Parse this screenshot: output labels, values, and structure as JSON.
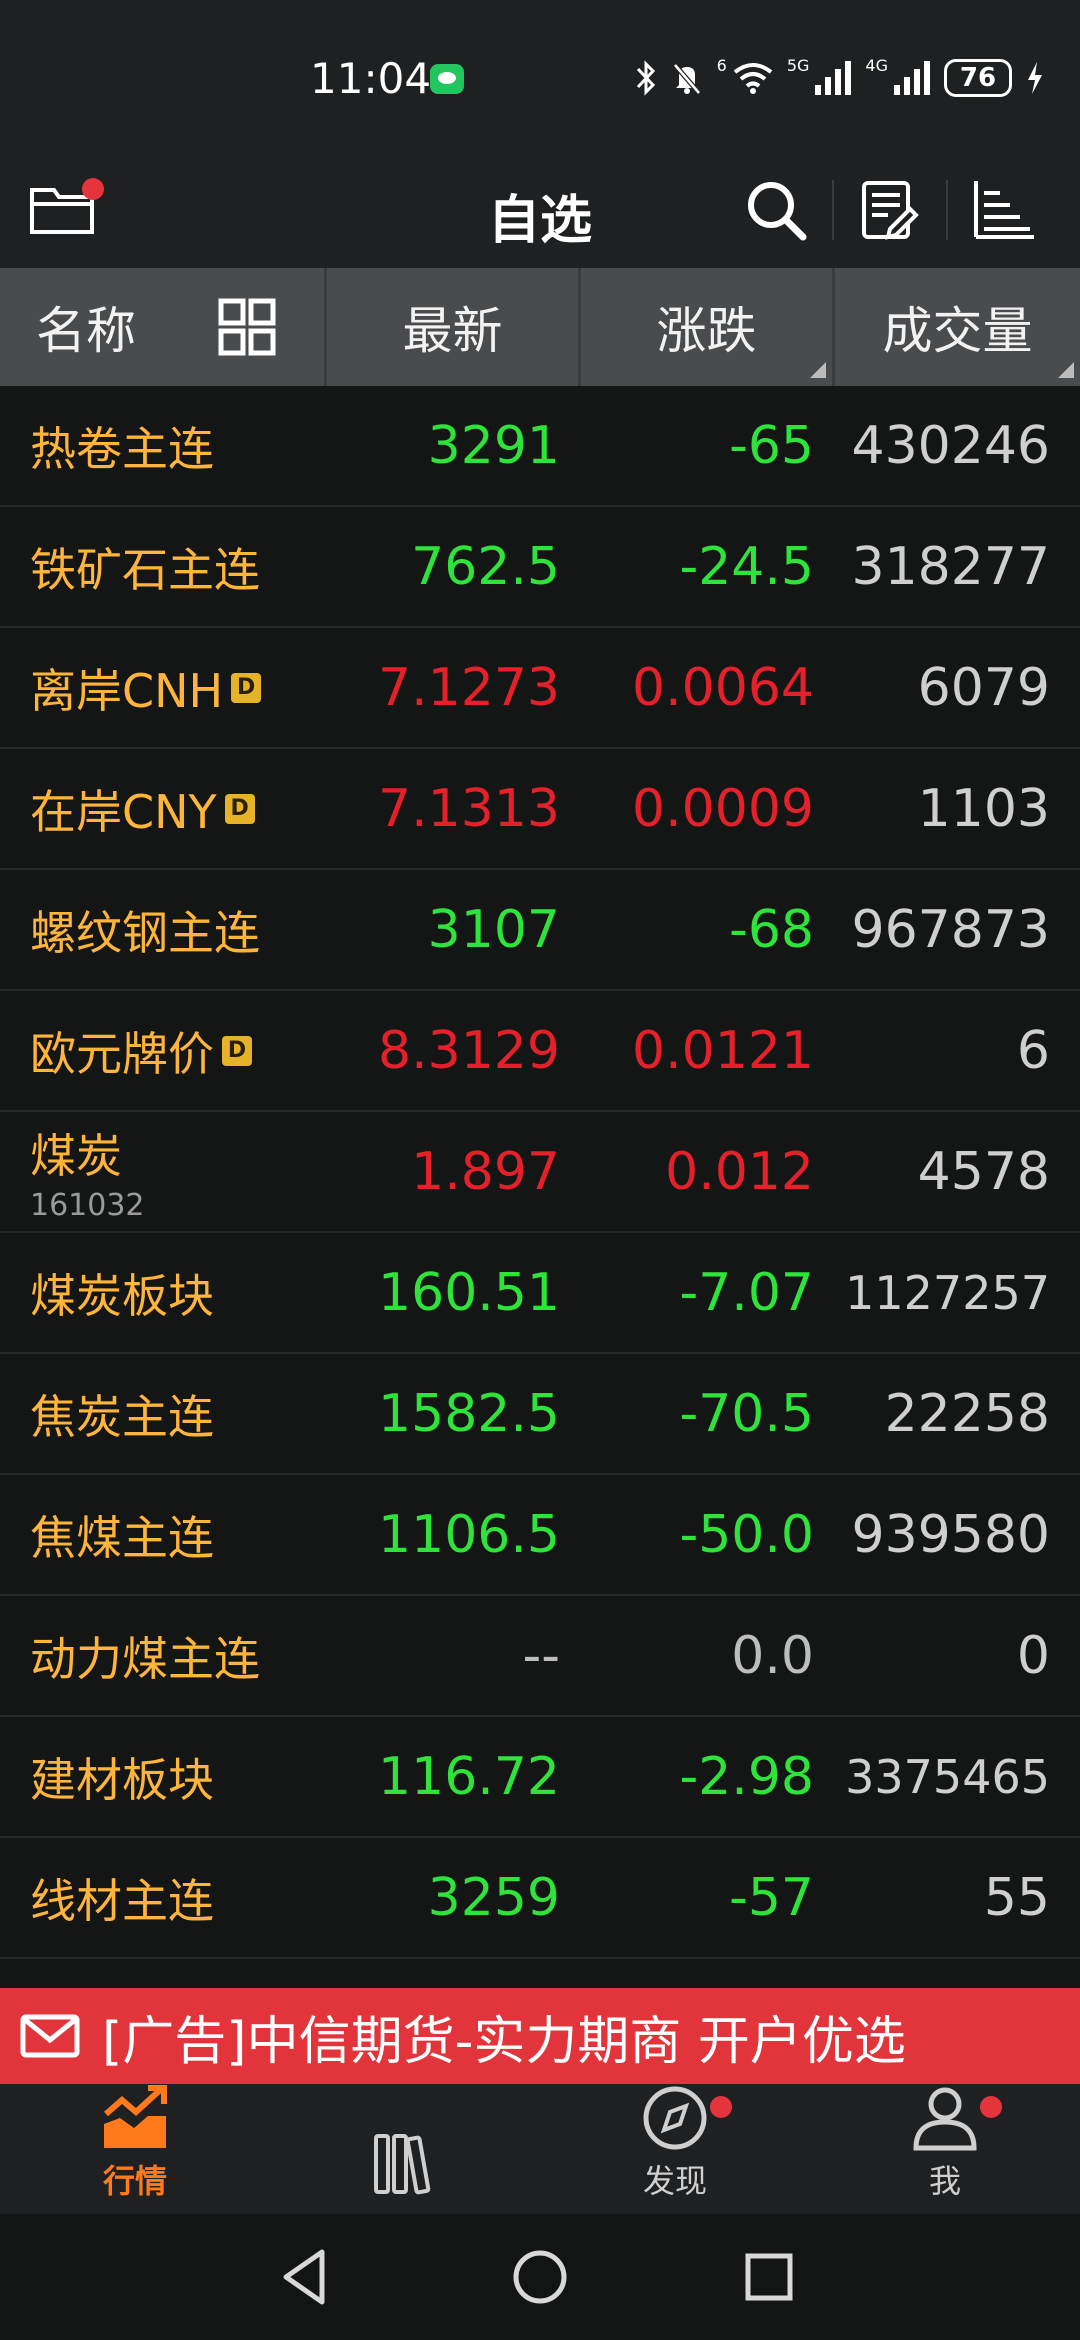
{
  "status_bar": {
    "time": "11:04",
    "battery": "76",
    "network_tags": [
      "6",
      "5G",
      "4G"
    ]
  },
  "header": {
    "title": "自选"
  },
  "columns": {
    "name": "名称",
    "latest": "最新",
    "change": "涨跌",
    "volume": "成交量"
  },
  "rows": [
    {
      "name": "热卷主连",
      "badge": "",
      "code": "",
      "latest": "3291",
      "change": "-65",
      "volume": "430246",
      "color": "green"
    },
    {
      "name": "铁矿石主连",
      "badge": "",
      "code": "",
      "latest": "762.5",
      "change": "-24.5",
      "volume": "318277",
      "color": "green"
    },
    {
      "name": "离岸CNH",
      "badge": "D",
      "code": "",
      "latest": "7.1273",
      "change": "0.0064",
      "volume": "6079",
      "color": "red"
    },
    {
      "name": "在岸CNY",
      "badge": "D",
      "code": "",
      "latest": "7.1313",
      "change": "0.0009",
      "volume": "1103",
      "color": "red"
    },
    {
      "name": "螺纹钢主连",
      "badge": "",
      "code": "",
      "latest": "3107",
      "change": "-68",
      "volume": "967873",
      "color": "green"
    },
    {
      "name": "欧元牌价",
      "badge": "D",
      "code": "",
      "latest": "8.3129",
      "change": "0.0121",
      "volume": "6",
      "color": "red"
    },
    {
      "name": "煤炭",
      "badge": "",
      "code": "161032",
      "latest": "1.897",
      "change": "0.012",
      "volume": "4578",
      "color": "red"
    },
    {
      "name": "煤炭板块",
      "badge": "",
      "code": "",
      "latest": "160.51",
      "change": "-7.07",
      "volume": "1127257",
      "color": "green"
    },
    {
      "name": "焦炭主连",
      "badge": "",
      "code": "",
      "latest": "1582.5",
      "change": "-70.5",
      "volume": "22258",
      "color": "green"
    },
    {
      "name": "焦煤主连",
      "badge": "",
      "code": "",
      "latest": "1106.5",
      "change": "-50.0",
      "volume": "939580",
      "color": "green"
    },
    {
      "name": "动力煤主连",
      "badge": "",
      "code": "",
      "latest": "--",
      "change": "0.0",
      "volume": "0",
      "color": "gray"
    },
    {
      "name": "建材板块",
      "badge": "",
      "code": "",
      "latest": "116.72",
      "change": "-2.98",
      "volume": "3375465",
      "color": "green"
    },
    {
      "name": "线材主连",
      "badge": "",
      "code": "",
      "latest": "3259",
      "change": "-57",
      "volume": "55",
      "color": "green"
    }
  ],
  "ad": {
    "text": "[广告]中信期货-实力期商 开户优选"
  },
  "tabs": [
    {
      "label": "行情",
      "icon": "market-chart-icon",
      "active": true
    },
    {
      "label": "",
      "icon": "books-icon",
      "active": false
    },
    {
      "label": "发现",
      "icon": "compass-icon",
      "active": false
    },
    {
      "label": "我",
      "icon": "person-icon",
      "active": false
    }
  ],
  "colors": {
    "up": "#e5202b",
    "down": "#2ee43a",
    "name": "#ffb43b",
    "accent": "#ff7a1a",
    "ad_bg": "#e1343b"
  }
}
